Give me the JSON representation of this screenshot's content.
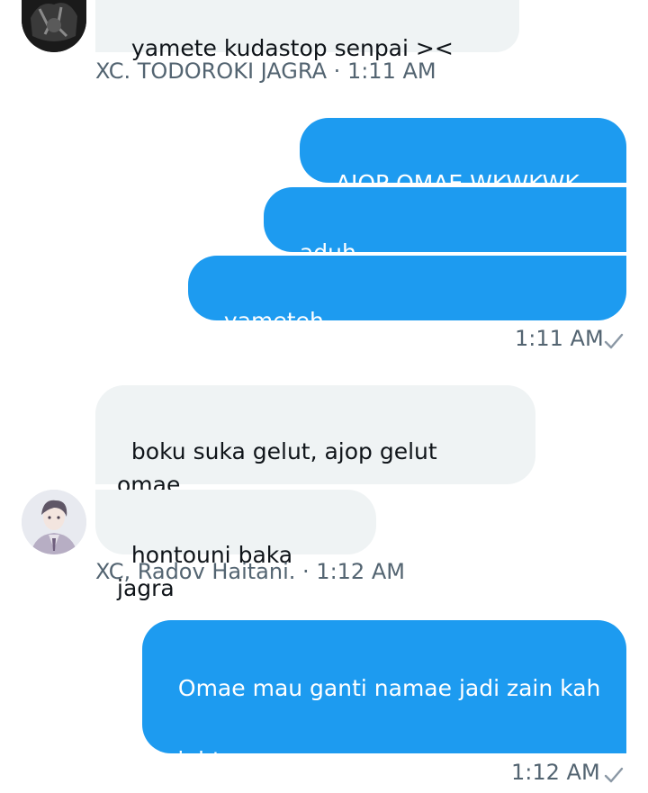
{
  "conversation": {
    "group1": {
      "messages": [
        "yamete kudastop senpai ><"
      ],
      "sender": "XC. TODOROKI JAGRA",
      "separator": "·",
      "time": "1:11 AM"
    },
    "group2": {
      "messages": [
        "AJOP OMAE WKWKWK",
        "aduh",
        "yameteh"
      ],
      "time": "1:11 AM",
      "status_icon": "sent-check-icon"
    },
    "group3": {
      "messages": [
        "boku suka gelut, ajop gelut\nomae",
        "hontouni baka jagra"
      ],
      "sender": "XC, Radov Haitani.",
      "separator": "·",
      "time": "1:12 AM"
    },
    "group4": {
      "messages": [
        "Omae mau ganti namae jadi zain kah\n\naight"
      ],
      "time": "1:12 AM",
      "status_icon": "sent-check-icon"
    }
  },
  "colors": {
    "outgoing_bubble": "#1d9bf0",
    "incoming_bubble": "#eff3f4",
    "meta_text": "#536471"
  }
}
